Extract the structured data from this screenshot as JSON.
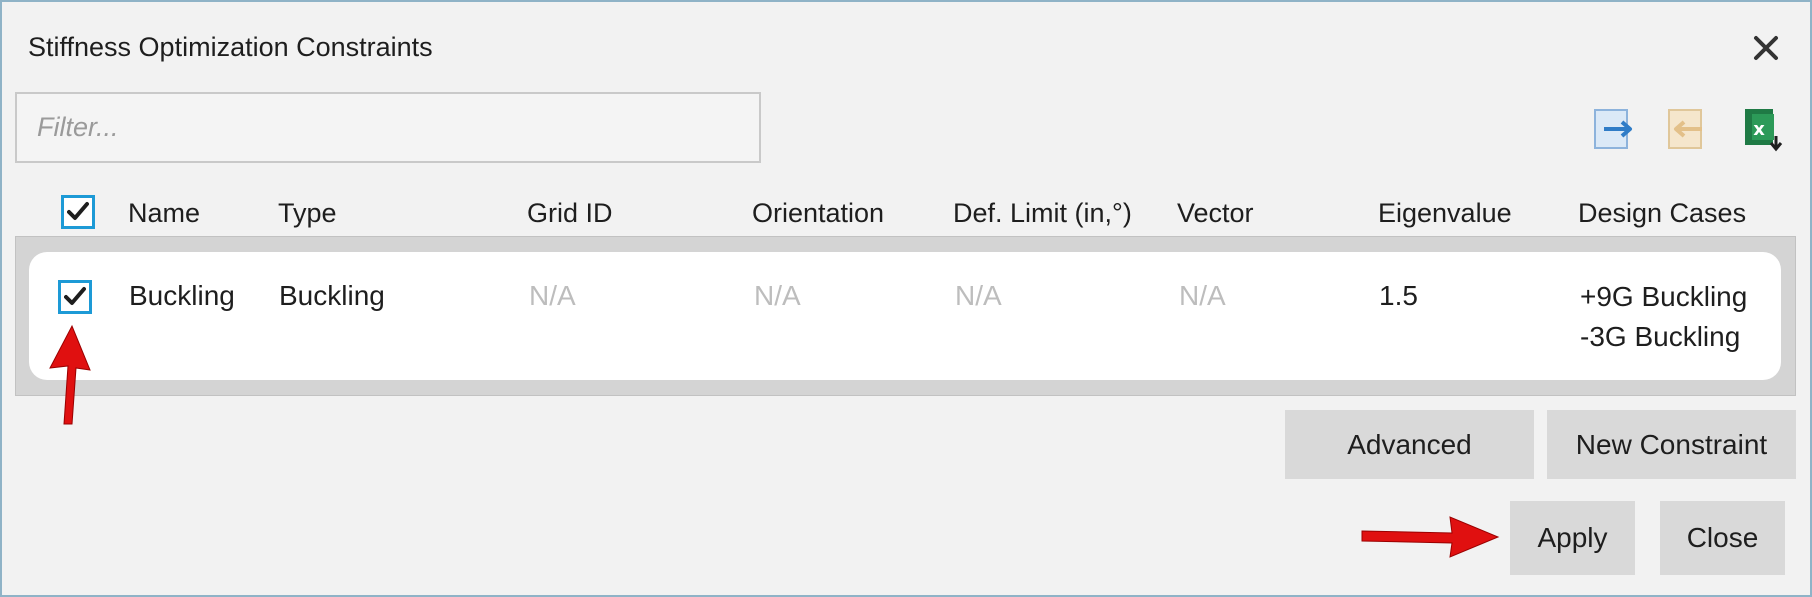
{
  "dialog": {
    "title": "Stiffness Optimization Constraints",
    "close_icon": "close-icon"
  },
  "filter": {
    "placeholder": "Filter...",
    "value": ""
  },
  "toolbar": {
    "icons": [
      "import-icon",
      "export-icon",
      "excel-export-icon"
    ]
  },
  "table": {
    "select_all_checked": true,
    "headers": {
      "name": "Name",
      "type": "Type",
      "grid_id": "Grid ID",
      "orientation": "Orientation",
      "def_limit": "Def. Limit (in,°)",
      "vector": "Vector",
      "eigenvalue": "Eigenvalue",
      "design_cases": "Design Cases"
    },
    "rows": [
      {
        "checked": true,
        "name": "Buckling",
        "type": "Buckling",
        "grid_id": "N/A",
        "orientation": "N/A",
        "def_limit": "N/A",
        "vector": "N/A",
        "eigenvalue": "1.5",
        "design_cases": [
          "+9G Buckling",
          "-3G Buckling"
        ]
      }
    ]
  },
  "buttons": {
    "advanced": "Advanced",
    "new_constraint": "New Constraint",
    "apply": "Apply",
    "close": "Close"
  },
  "colors": {
    "accent": "#1d9ad6",
    "annotation_arrow": "#e01010",
    "na_text": "#bdbdbd",
    "button_bg": "#d9d9d9"
  }
}
